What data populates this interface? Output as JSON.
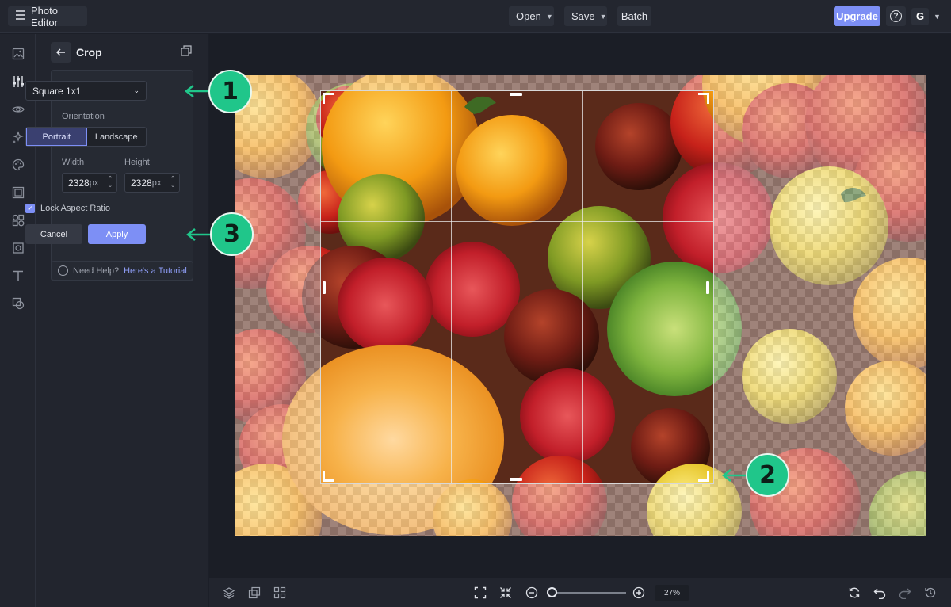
{
  "header": {
    "app_name": "Photo Editor",
    "open_label": "Open",
    "save_label": "Save",
    "batch_label": "Batch",
    "upgrade_label": "Upgrade",
    "help_glyph": "?",
    "user_initial": "G"
  },
  "panel": {
    "title": "Crop",
    "preset": "Square 1x1",
    "orientation_label": "Orientation",
    "orientation_options": [
      "Portrait",
      "Landscape"
    ],
    "orientation_selected": "Portrait",
    "width_label": "Width",
    "height_label": "Height",
    "width_value": "2328",
    "height_value": "2328",
    "unit": "px",
    "lock_label": "Lock Aspect Ratio",
    "lock_checked": true,
    "cancel_label": "Cancel",
    "apply_label": "Apply",
    "help_text": "Need Help?",
    "help_link": "Here's a Tutorial"
  },
  "callouts": [
    "1",
    "2",
    "3"
  ],
  "zoom": {
    "value": "27%",
    "level": 0.0
  },
  "colors": {
    "accent": "#7d8ff5",
    "callout": "#20c68a",
    "background": "#1c1f28"
  }
}
